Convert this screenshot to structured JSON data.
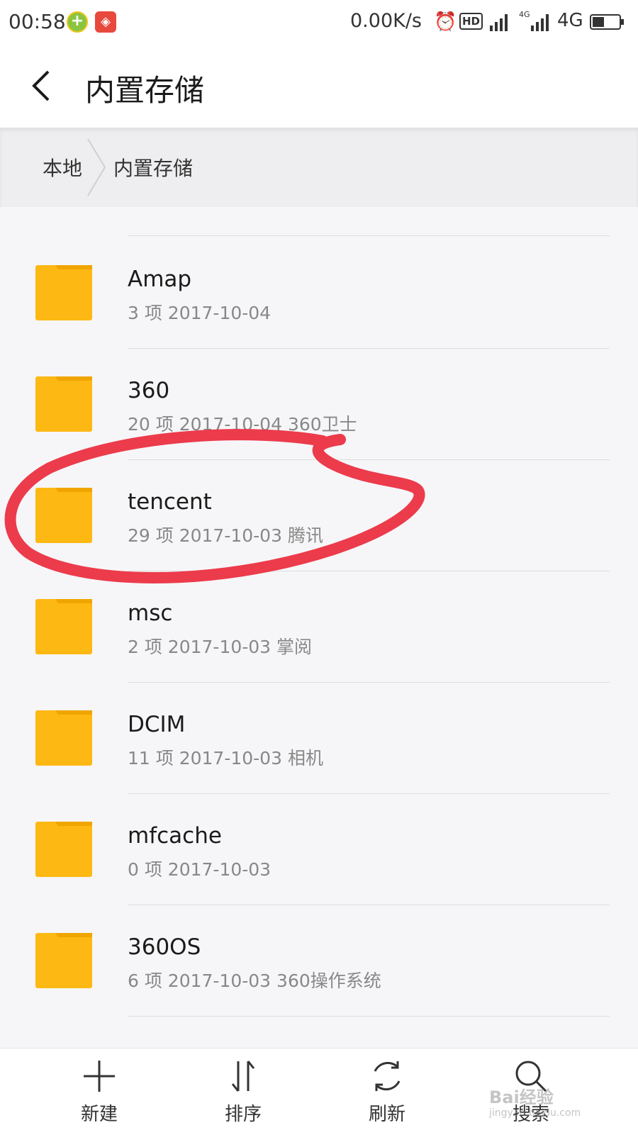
{
  "status_bar": {
    "time": "00:58",
    "speed": "0.00K/s",
    "hd_label": "HD",
    "small_4g": "4G",
    "network": "4G"
  },
  "header": {
    "title": "内置存储"
  },
  "breadcrumb": {
    "root": "本地",
    "current": "内置存储"
  },
  "files": [
    {
      "name": "Amap",
      "meta": "3 项  2017-10-04"
    },
    {
      "name": "360",
      "meta": "20 项  2017-10-04  360卫士"
    },
    {
      "name": "tencent",
      "meta": "29 项  2017-10-03  腾讯"
    },
    {
      "name": "msc",
      "meta": "2 项  2017-10-03  掌阅"
    },
    {
      "name": "DCIM",
      "meta": "11 项  2017-10-03  相机"
    },
    {
      "name": "mfcache",
      "meta": "0 项  2017-10-03"
    },
    {
      "name": "360OS",
      "meta": "6 项  2017-10-03  360操作系统"
    }
  ],
  "toolbar": {
    "new_label": "新建",
    "sort_label": "排序",
    "refresh_label": "刷新",
    "search_label": "搜索"
  },
  "watermark": {
    "text": "Bai经验",
    "sub": "jingyan.baidu.com"
  },
  "colors": {
    "folder": "#fdb813",
    "folder_tab": "#f0a500",
    "annotation": "#ec3b4b"
  }
}
